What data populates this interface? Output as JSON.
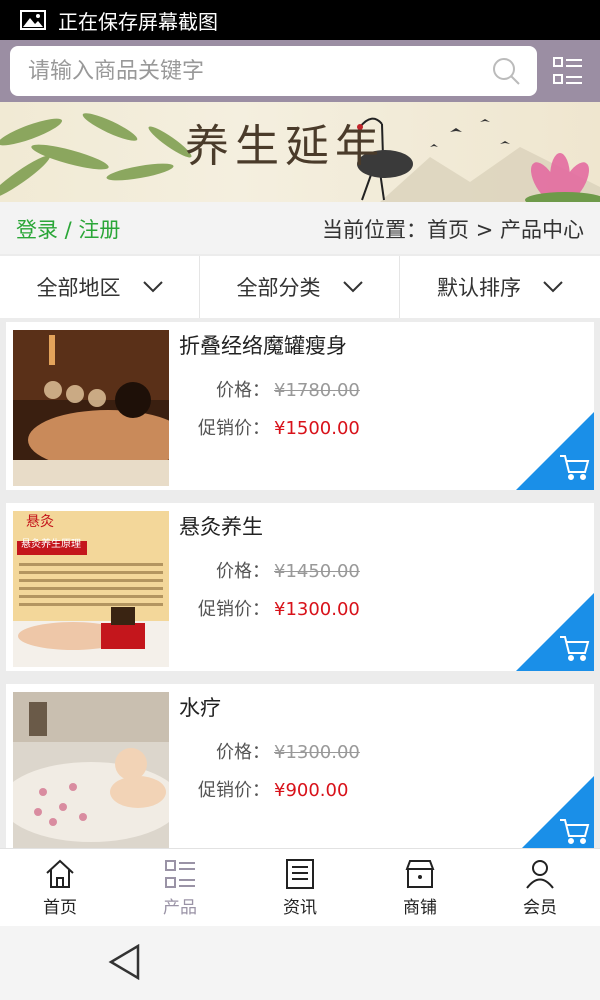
{
  "statusbar": {
    "text": "正在保存屏幕截图"
  },
  "search": {
    "placeholder": "请输入商品关键字"
  },
  "banner": {
    "calligraphy": "养生延年"
  },
  "login_row": {
    "login": "登录 / 注册",
    "location": "当前位置：首页 > 产品中心"
  },
  "filters": [
    {
      "label": "全部地区"
    },
    {
      "label": "全部分类"
    },
    {
      "label": "默认排序"
    }
  ],
  "labels": {
    "price": "价格：",
    "promo": "促销价："
  },
  "products": [
    {
      "name": "折叠经络魔罐瘦身",
      "price": "¥1780.00",
      "promo_price": "¥1500.00"
    },
    {
      "name": "悬灸养生",
      "price": "¥1450.00",
      "promo_price": "¥1300.00",
      "image_title": "悬灸",
      "image_subtitle": "悬灸养生原理"
    },
    {
      "name": "水疗",
      "price": "¥1300.00",
      "promo_price": "¥900.00"
    }
  ],
  "bottom_nav": [
    {
      "label": "首页",
      "icon": "home-icon"
    },
    {
      "label": "产品",
      "icon": "list-icon",
      "active": true
    },
    {
      "label": "资讯",
      "icon": "news-icon"
    },
    {
      "label": "商铺",
      "icon": "shop-icon"
    },
    {
      "label": "会员",
      "icon": "user-icon"
    }
  ],
  "colors": {
    "header": "#9b8ea3",
    "accent_green": "#2aa637",
    "price_red": "#d8121a",
    "cart_blue": "#1a8fe8"
  }
}
